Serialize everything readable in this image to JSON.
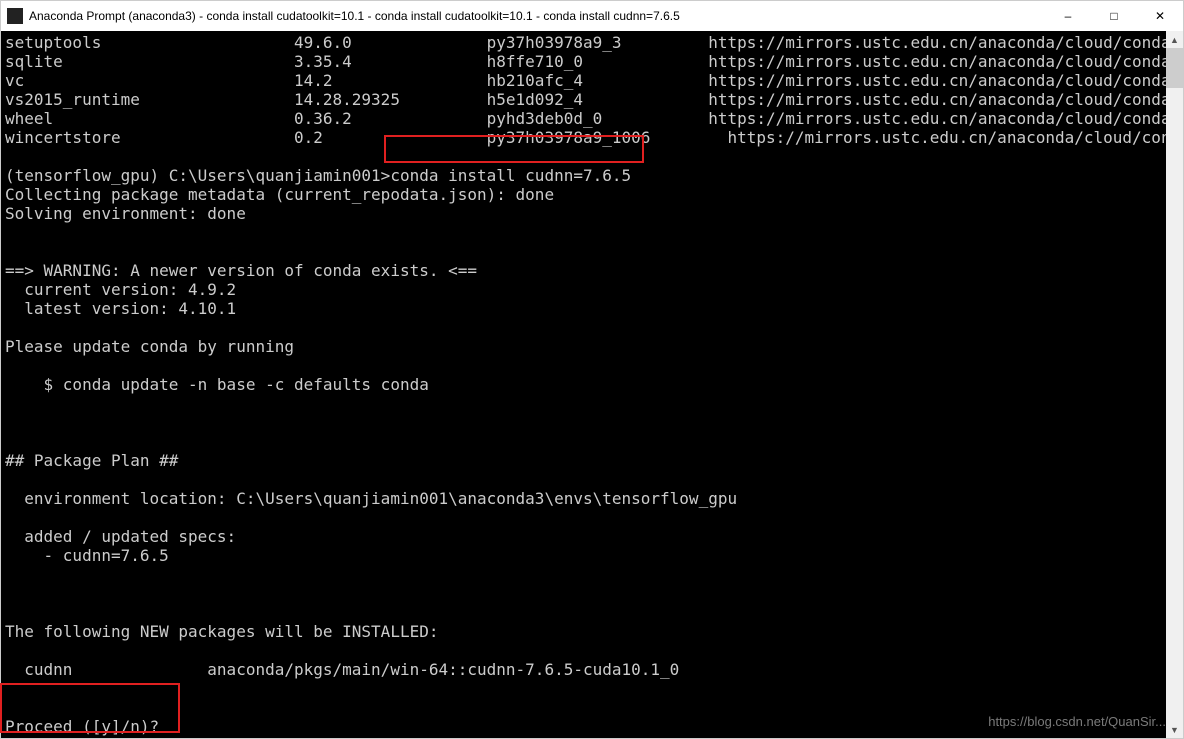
{
  "window": {
    "title": "Anaconda Prompt (anaconda3) - conda  install cudatoolkit=10.1 - conda  install cudatoolkit=10.1 - conda  install cudnn=7.6.5"
  },
  "terminal": {
    "packages": [
      {
        "name": "setuptools",
        "version": "49.6.0",
        "build": "py37h03978a9_3",
        "channel": "https://mirrors.ustc.edu.cn/anaconda/cloud/conda-forge"
      },
      {
        "name": "sqlite",
        "version": "3.35.4",
        "build": "h8ffe710_0",
        "channel": "https://mirrors.ustc.edu.cn/anaconda/cloud/conda-forge"
      },
      {
        "name": "vc",
        "version": "14.2",
        "build": "hb210afc_4",
        "channel": "https://mirrors.ustc.edu.cn/anaconda/cloud/conda-forge"
      },
      {
        "name": "vs2015_runtime",
        "version": "14.28.29325",
        "build": "h5e1d092_4",
        "channel": "https://mirrors.ustc.edu.cn/anaconda/cloud/conda-forge"
      },
      {
        "name": "wheel",
        "version": "0.36.2",
        "build": "pyhd3deb0d_0",
        "channel": "https://mirrors.ustc.edu.cn/anaconda/cloud/conda-forge"
      },
      {
        "name": "wincertstore",
        "version": "0.2",
        "build": "py37h03978a9_1006",
        "channel": "https://mirrors.ustc.edu.cn/anaconda/cloud/conda-forge"
      }
    ],
    "prompt_prefix": "(tensorflow_gpu) C:\\Users\\quanjiamin001>",
    "command": "conda install cudnn=7.6.5",
    "collecting": "Collecting package metadata (current_repodata.json): done",
    "solving": "Solving environment: done",
    "warn_header": "==> WARNING: A newer version of conda exists. <==",
    "warn_current": "  current version: 4.9.2",
    "warn_latest": "  latest version: 4.10.1",
    "update_msg": "Please update conda by running",
    "update_cmd": "    $ conda update -n base -c defaults conda",
    "plan_header": "## Package Plan ##",
    "env_location": "  environment location: C:\\Users\\quanjiamin001\\anaconda3\\envs\\tensorflow_gpu",
    "added_specs_label": "  added / updated specs:",
    "added_spec_item": "    - cudnn=7.6.5",
    "new_pkgs_header": "The following NEW packages will be INSTALLED:",
    "new_pkg_line": "  cudnn              anaconda/pkgs/main/win-64::cudnn-7.6.5-cuda10.1_0",
    "proceed": "Proceed ([y]/n)?"
  },
  "watermark": "https://blog.csdn.net/QuanSir..."
}
